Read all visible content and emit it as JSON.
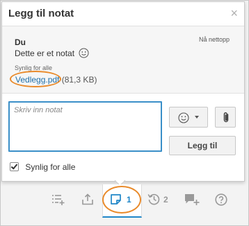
{
  "dialog": {
    "title": "Legg til notat",
    "close_glyph": "×"
  },
  "note": {
    "author": "Du",
    "time": "Nå nettopp",
    "text": "Dette er et notat",
    "emoji_icon": "smiley-icon",
    "visibility": "Synlig for alle",
    "attachment_name": "Vedlegg.pdf",
    "attachment_size": "(81,3 KB)"
  },
  "composer": {
    "placeholder": "Skriv inn notat",
    "emoji_icon": "smiley-icon",
    "attach_icon": "paperclip-icon",
    "submit_label": "Legg til",
    "checkbox_label": "Synlig for alle",
    "checkbox_checked": true
  },
  "toolbar": {
    "items": [
      {
        "icon": "list-add-icon"
      },
      {
        "icon": "upload-icon"
      },
      {
        "icon": "note-icon",
        "count": "1",
        "active": true
      },
      {
        "icon": "history-icon",
        "count": "2"
      },
      {
        "icon": "chat-add-icon"
      },
      {
        "icon": "help-icon"
      }
    ]
  },
  "colors": {
    "link": "#1f6fa8",
    "focus_border": "#3a8fc8",
    "highlight_ring": "#e98a2a",
    "active_tab": "#1f86c8"
  }
}
